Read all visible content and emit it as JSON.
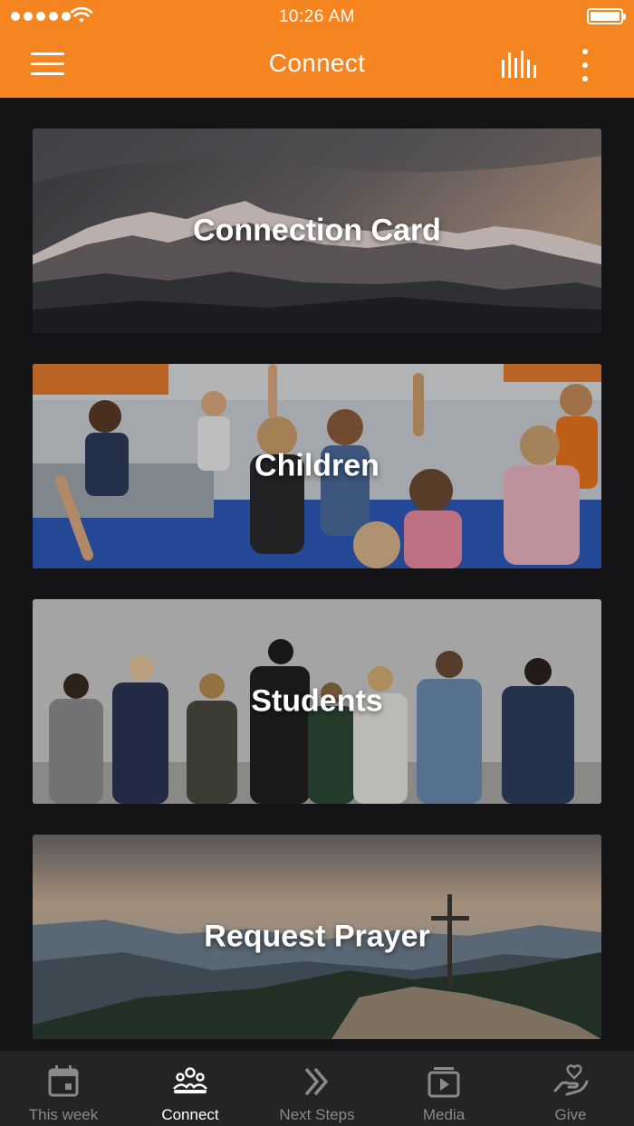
{
  "status_bar": {
    "time": "10:26 AM"
  },
  "header": {
    "title": "Connect",
    "menu_icon": "hamburger-menu-icon",
    "chart_icon": "bar-chart-icon",
    "more_icon": "more-vertical-icon"
  },
  "colors": {
    "accent": "#f48521",
    "background": "#141416",
    "tabbar": "#242426",
    "tab_inactive": "#8a8a8c",
    "tab_active": "#ffffff"
  },
  "cards": [
    {
      "label": "Connection Card",
      "image": "mountain-range-sunset-photo"
    },
    {
      "label": "Children",
      "image": "children-raising-hands-photo"
    },
    {
      "label": "Students",
      "image": "group-of-students-walking-photo"
    },
    {
      "label": "Request Prayer",
      "image": "cross-on-mountain-photo"
    }
  ],
  "tabs": [
    {
      "label": "This week",
      "icon": "calendar-icon",
      "active": false
    },
    {
      "label": "Connect",
      "icon": "people-group-icon",
      "active": true
    },
    {
      "label": "Next Steps",
      "icon": "double-chevron-right-icon",
      "active": false
    },
    {
      "label": "Media",
      "icon": "media-play-icon",
      "active": false
    },
    {
      "label": "Give",
      "icon": "hand-heart-icon",
      "active": false
    }
  ]
}
